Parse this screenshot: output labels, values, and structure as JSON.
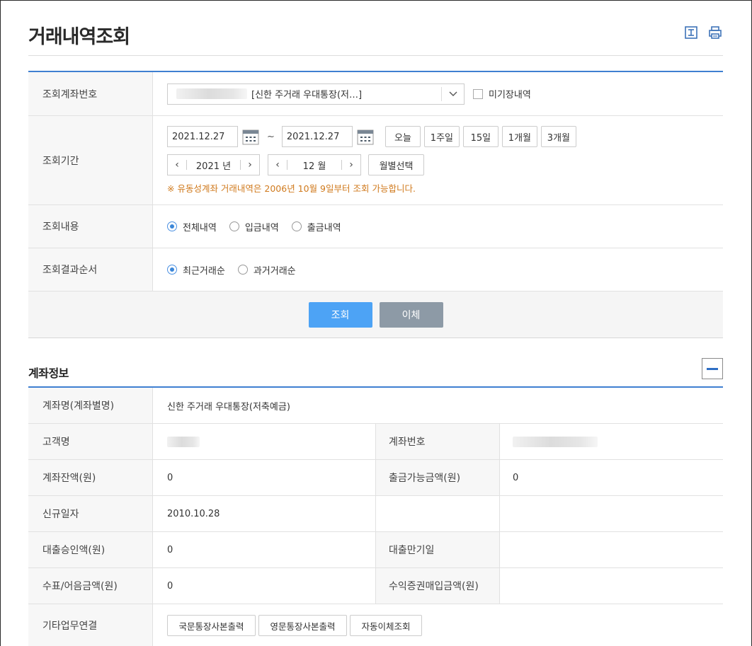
{
  "page": {
    "title": "거래내역조회"
  },
  "search": {
    "account_label": "조회계좌번호",
    "account_name": "[신한 주거래 우대통장(저…]",
    "unrecorded_label": "미기장내역",
    "period_label": "조회기간",
    "date_from": "2021.12.27",
    "date_to": "2021.12.27",
    "tilde": "~",
    "quick_buttons": [
      "오늘",
      "1주일",
      "15일",
      "1개월",
      "3개월"
    ],
    "year_value": "2021 년",
    "month_value": "12 월",
    "month_select_label": "월별선택",
    "notice": "※ 유동성계좌 거래내역은 2006년 10월 9일부터 조회 가능합니다.",
    "content_label": "조회내용",
    "content_options": [
      "전체내역",
      "입금내역",
      "출금내역"
    ],
    "order_label": "조회결과순서",
    "order_options": [
      "최근거래순",
      "과거거래순"
    ]
  },
  "actions": {
    "search_button": "조회",
    "transfer_button": "이체"
  },
  "account_info": {
    "section_title": "계좌정보",
    "rows": {
      "name_label": "계좌명(계좌별명)",
      "name_value": "신한 주거래 우대통장(저축예금)",
      "customer_label": "고객명",
      "account_no_label": "계좌번호",
      "balance_label": "계좌잔액(원)",
      "balance_value": "0",
      "withdrawable_label": "출금가능금액(원)",
      "withdrawable_value": "0",
      "open_date_label": "신규일자",
      "open_date_value": "2010.10.28",
      "loan_limit_label": "대출승인액(원)",
      "loan_limit_value": "0",
      "loan_due_label": "대출만기일",
      "check_label": "수표/어음금액(원)",
      "check_value": "0",
      "securities_label": "수익증권매입금액(원)",
      "other_label": "기타업무연결",
      "other_buttons": [
        "국문통장사본출력",
        "영문통장사본출력",
        "자동이체조회"
      ]
    }
  }
}
